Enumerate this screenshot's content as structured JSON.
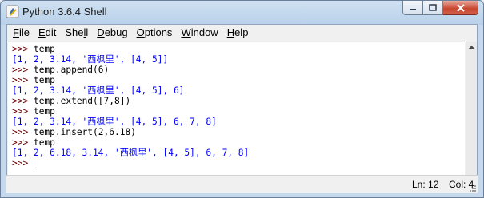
{
  "window": {
    "title": "Python 3.6.4 Shell"
  },
  "menu": [
    {
      "label": "File",
      "key": "F",
      "rest": "ile"
    },
    {
      "label": "Edit",
      "key": "E",
      "rest": "dit"
    },
    {
      "label": "Shell",
      "pre": "She",
      "key": "l",
      "rest": "l"
    },
    {
      "label": "Debug",
      "key": "D",
      "rest": "ebug"
    },
    {
      "label": "Options",
      "key": "O",
      "rest": "ptions"
    },
    {
      "label": "Window",
      "key": "W",
      "rest": "indow"
    },
    {
      "label": "Help",
      "key": "H",
      "rest": "elp"
    }
  ],
  "shell": {
    "prompt": ">>> ",
    "lines": [
      {
        "type": "cmd",
        "text": "temp"
      },
      {
        "type": "out",
        "text": "[1, 2, 3.14, '西枫里', [4, 5]]"
      },
      {
        "type": "cmd",
        "text": "temp.append(6)"
      },
      {
        "type": "cmd",
        "text": "temp"
      },
      {
        "type": "out",
        "text": "[1, 2, 3.14, '西枫里', [4, 5], 6]"
      },
      {
        "type": "cmd",
        "text": "temp.extend([7,8])"
      },
      {
        "type": "cmd",
        "text": "temp"
      },
      {
        "type": "out",
        "text": "[1, 2, 3.14, '西枫里', [4, 5], 6, 7, 8]"
      },
      {
        "type": "cmd",
        "text": "temp.insert(2,6.18)"
      },
      {
        "type": "cmd",
        "text": "temp"
      },
      {
        "type": "out",
        "text": "[1, 2, 6.18, 3.14, '西枫里', [4, 5], 6, 7, 8]"
      },
      {
        "type": "cmd",
        "text": ""
      }
    ]
  },
  "status": {
    "line": "Ln: 12",
    "col": "Col: 4"
  },
  "colors": {
    "prompt": "#660000",
    "output": "#0000ff",
    "code": "#000000"
  }
}
